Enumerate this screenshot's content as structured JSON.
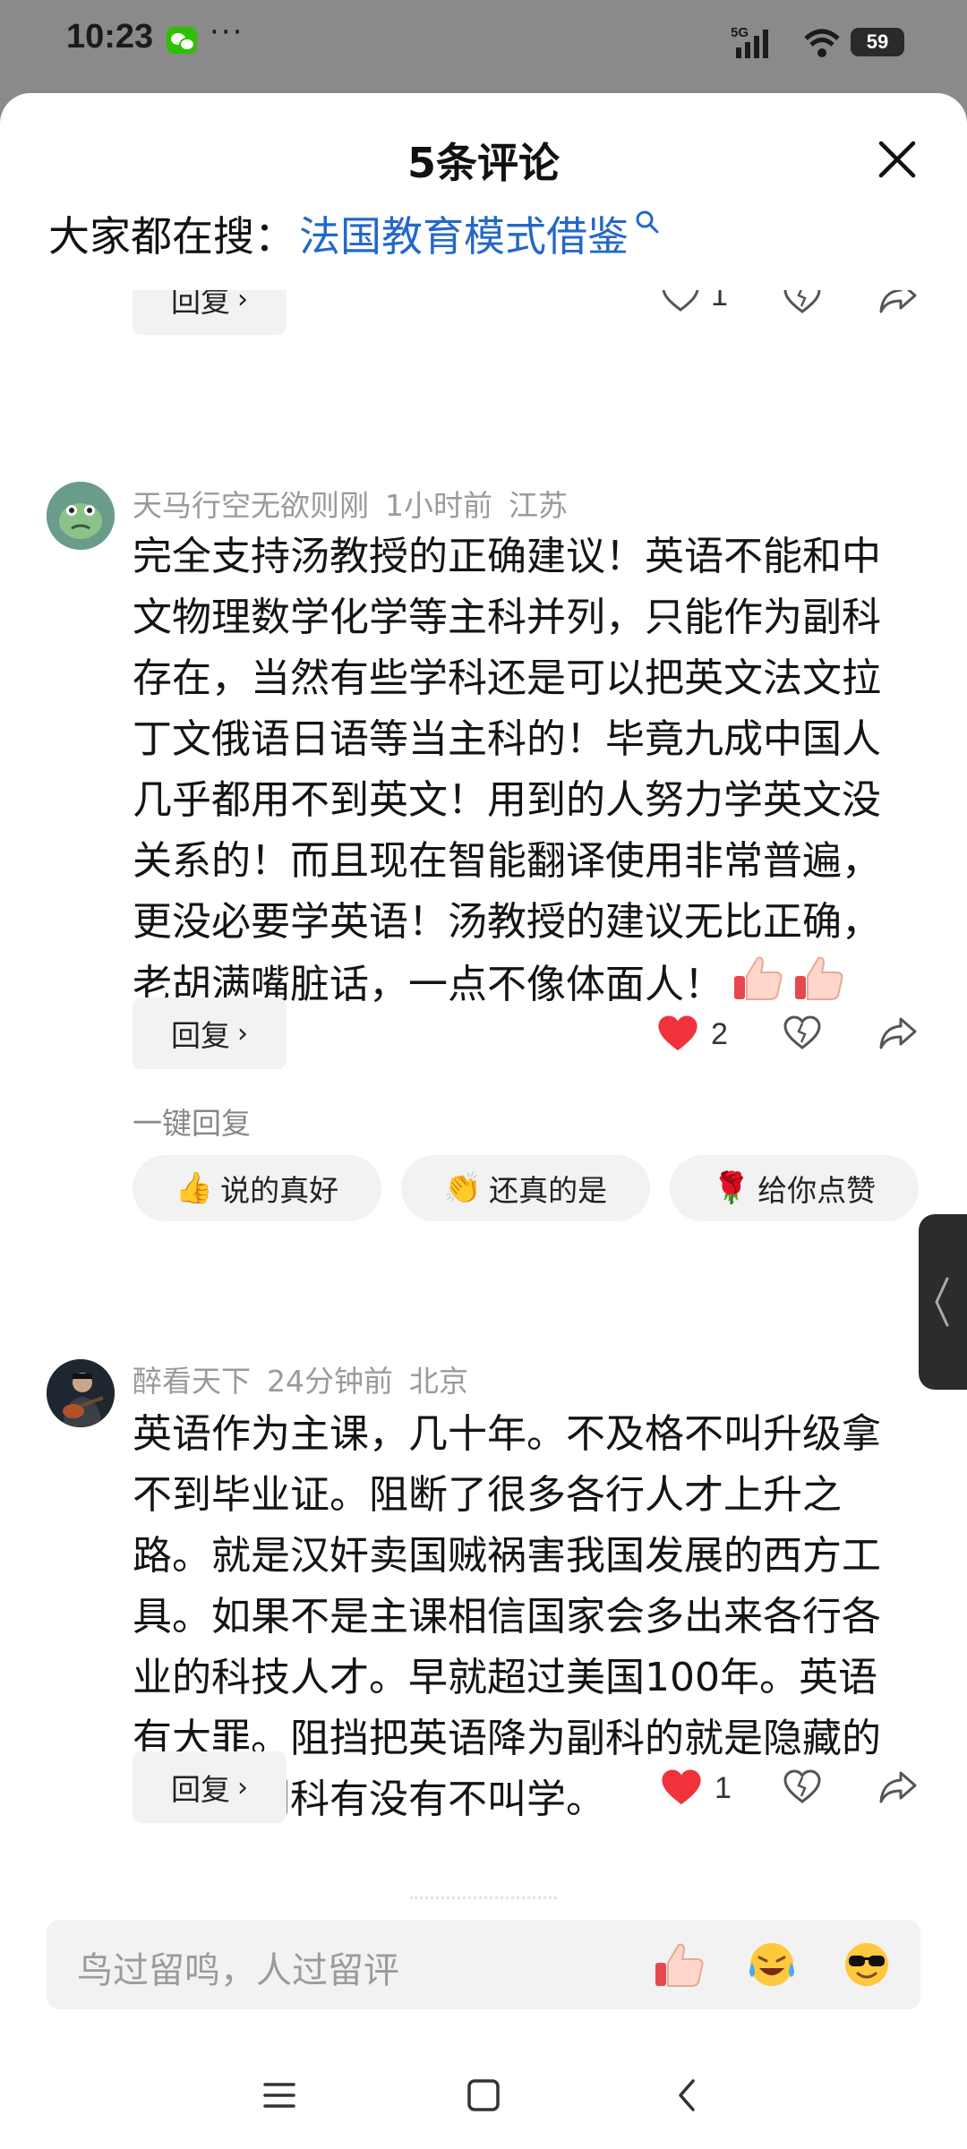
{
  "status_bar": {
    "time": "10:23",
    "dots": "···",
    "network": "5G",
    "battery": "59"
  },
  "sheet": {
    "title": "5条评论",
    "search_prefix": "大家都在搜：",
    "search_link": "法国教育模式借鉴"
  },
  "top_partial": {
    "reply_label": "回复",
    "like_count": "1"
  },
  "comments": [
    {
      "username": "天马行空无欲则刚",
      "time": "1小时前",
      "location": "江苏",
      "text": "完全支持汤教授的正确建议！英语不能和中文物理数学化学等主科并列，只能作为副科存在，当然有些学科还是可以把英文法文拉丁文俄语日语等当主科的！毕竟九成中国人几乎都用不到英文！用到的人努力学英文没关系的！而且现在智能翻译使用非常普遍，更没必要学英语！汤教授的建议无比正确，老胡满嘴脏话，一点不像体面人！",
      "trailing_emojis": [
        "thumbs-up-icon",
        "thumbs-up-icon",
        "thumbs-up-icon"
      ],
      "reply_label": "回复",
      "like_count": "2",
      "liked": true
    },
    {
      "username": "醉看天下",
      "time": "24分钟前",
      "location": "北京",
      "text": "英语作为主课，几十年。不及格不叫升级拿不到毕业证。阻断了很多各行人才上升之路。就是汉奸卖国贼祸害我国发展的西方工具。如果不是主课相信国家会多出来各行各业的科技人才。早就超过美国100年。英语有大罪。阻挡把英语降为副科的就是隐藏的间谍。副科有没有不叫学。",
      "reply_label": "回复",
      "like_count": "1",
      "liked": true
    }
  ],
  "quick_reply": {
    "label": "一键回复",
    "chips": [
      {
        "emoji": "👍",
        "text": "说的真好"
      },
      {
        "emoji": "👏",
        "text": "还真的是"
      },
      {
        "emoji": "🌹",
        "text": "给你点赞"
      }
    ]
  },
  "input": {
    "placeholder": "鸟过留鸣，人过留评"
  },
  "colors": {
    "link": "#2468c7",
    "like_red": "#f0323c",
    "muted": "#9a9a9a",
    "chip_bg": "#f2f2f2"
  }
}
